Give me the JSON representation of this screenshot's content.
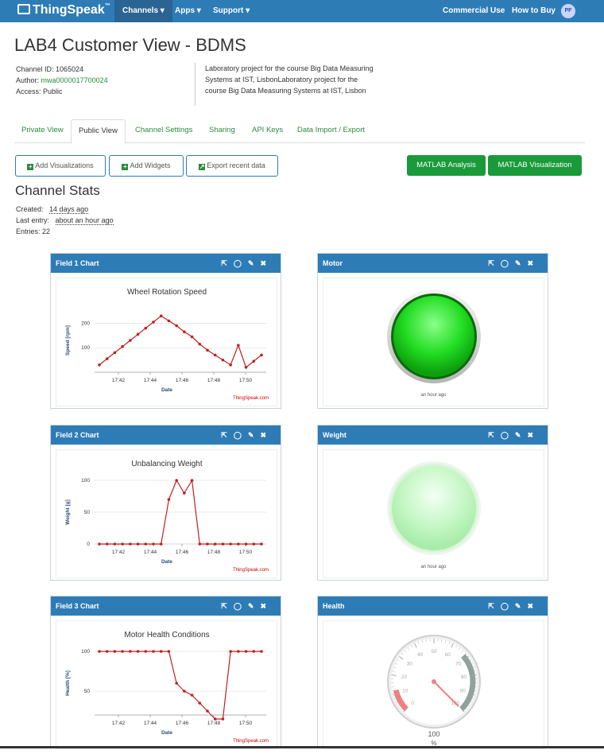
{
  "nav": {
    "brand": "ThingSpeak",
    "tm": "™",
    "items": [
      "Channels ▾",
      "Apps ▾",
      "Support ▾"
    ],
    "right": [
      "Commercial Use",
      "How to Buy"
    ],
    "avatar": "PF"
  },
  "channel": {
    "title": "LAB4 Customer View - BDMS",
    "id_label": "Channel ID:",
    "id": "1065024",
    "author_label": "Author:",
    "author": "mwa0000017700024",
    "access_label": "Access:",
    "access": "Public",
    "description": "Laboratory project for the course Big Data Measuring Systems at IST, LisbonLaboratory project for the course Big Data Measuring Systems at IST, Lisbon"
  },
  "tabs": [
    "Private View",
    "Public View",
    "Channel Settings",
    "Sharing",
    "API Keys",
    "Data Import / Export"
  ],
  "buttons": {
    "add_vis": "Add Visualizations",
    "add_widgets": "Add Widgets",
    "export": "Export recent data",
    "matlab_analysis": "MATLAB Analysis",
    "matlab_vis": "MATLAB Visualization"
  },
  "stats": {
    "title": "Channel Stats",
    "created_label": "Created:",
    "created": "14 days ago",
    "last_label": "Last entry:",
    "last": "about an hour ago",
    "entries_label": "Entries:",
    "entries": "22"
  },
  "panels": {
    "f1": "Field 1 Chart",
    "motor": "Motor",
    "f2": "Field 2 Chart",
    "weight": "Weight",
    "f3": "Field 3 Chart",
    "health": "Health"
  },
  "lamp_time": "an hour ago",
  "credit": "ThingSpeak.com",
  "gauge": {
    "value": "100",
    "unit": "%",
    "ticks": [
      "0",
      "10",
      "20",
      "30",
      "40",
      "50",
      "60",
      "70",
      "80",
      "90",
      "100"
    ]
  },
  "colors": {
    "nav": "#2e7cb6",
    "green_button": "#1a9a3a",
    "line": "#c02020",
    "lamp_on": "#22dd22",
    "lamp_off": "#b8f5b8"
  },
  "chart_data": [
    {
      "type": "line",
      "title": "Wheel Rotation Speed",
      "xlabel": "Date",
      "ylabel": "Speed [rpm]",
      "x_ticks": [
        "17:42",
        "17:44",
        "17:46",
        "17:48",
        "17:50"
      ],
      "y_ticks": [
        100,
        200
      ],
      "ylim": [
        0,
        260
      ],
      "values": [
        30,
        55,
        80,
        105,
        130,
        155,
        180,
        205,
        230,
        210,
        190,
        165,
        145,
        115,
        90,
        70,
        50,
        30,
        110,
        20,
        45,
        70
      ]
    },
    {
      "type": "line",
      "title": "Unbalancing Weight",
      "xlabel": "Date",
      "ylabel": "Weight [g]",
      "x_ticks": [
        "17:42",
        "17:44",
        "17:46",
        "17:48",
        "17:50"
      ],
      "y_ticks": [
        0,
        50,
        100
      ],
      "ylim": [
        0,
        100
      ],
      "values": [
        0,
        0,
        0,
        0,
        0,
        0,
        0,
        0,
        0,
        70,
        100,
        80,
        100,
        0,
        0,
        0,
        0,
        0,
        0,
        0,
        0,
        0
      ]
    },
    {
      "type": "line",
      "title": "Motor Health Conditions",
      "xlabel": "Date",
      "ylabel": "Health [%]",
      "x_ticks": [
        "17:42",
        "17:44",
        "17:46",
        "17:48",
        "17:50"
      ],
      "y_ticks": [
        50,
        100
      ],
      "ylim": [
        20,
        100
      ],
      "values": [
        100,
        100,
        100,
        100,
        100,
        100,
        100,
        100,
        100,
        100,
        60,
        50,
        45,
        35,
        25,
        15,
        15,
        100,
        100,
        100,
        100,
        100
      ]
    }
  ]
}
